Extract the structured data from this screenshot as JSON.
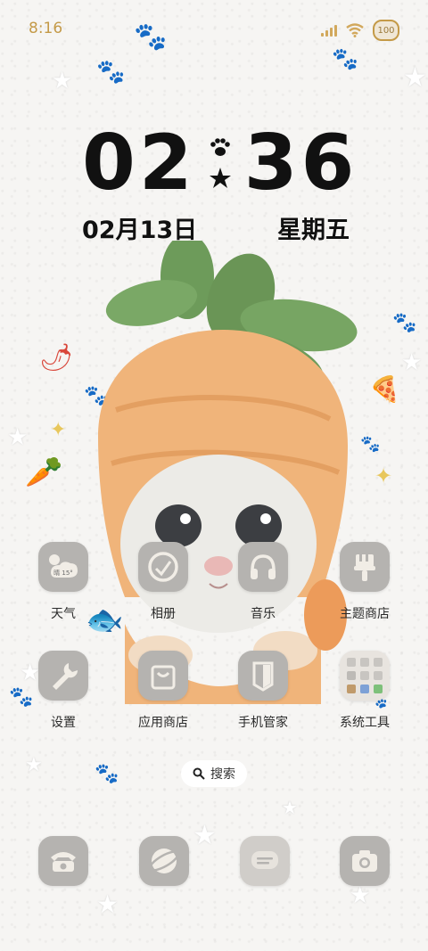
{
  "status_bar": {
    "time": "8:16",
    "battery": "100"
  },
  "clock": {
    "hours": "02",
    "minutes": "36",
    "date": "02月13日",
    "weekday": "星期五"
  },
  "apps": {
    "weather": {
      "label": "天气",
      "temp": "晴 15°"
    },
    "photos": {
      "label": "相册"
    },
    "music": {
      "label": "音乐"
    },
    "theme_store": {
      "label": "主题商店"
    },
    "settings": {
      "label": "设置"
    },
    "app_store": {
      "label": "应用商店"
    },
    "phone_manager": {
      "label": "手机管家"
    },
    "system_tools": {
      "label": "系统工具"
    }
  },
  "search": {
    "label": "搜索"
  },
  "dock": [
    "phone-icon",
    "browser-icon",
    "messages-icon",
    "camera-icon"
  ],
  "colors": {
    "status_accent": "#c49a48",
    "icon_bg": "#b5b3b0",
    "icon_glyph": "#f1ede6",
    "carrot_orange": "#f0b47a",
    "leaf_green": "#6d9b5a"
  }
}
